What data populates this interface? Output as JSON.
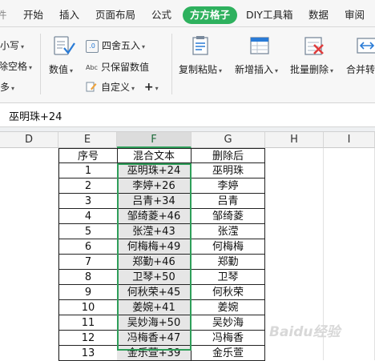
{
  "tabs": [
    {
      "label": "开始"
    },
    {
      "label": "插入"
    },
    {
      "label": "页面布局"
    },
    {
      "label": "公式"
    },
    {
      "label": "方方格子",
      "active": true
    },
    {
      "label": "DIY工具箱"
    },
    {
      "label": "数据"
    },
    {
      "label": "审阅"
    }
  ],
  "ribbon": {
    "lowercase": "小写",
    "remove_spaces": "除空格",
    "more": "多",
    "numeric": "数值",
    "round": "四舍五入",
    "keep_numeric": "只保留数值",
    "custom": "自定义",
    "plus": "+",
    "copy_paste": "复制粘贴",
    "new_insert": "新增插入",
    "batch_delete": "批量删除",
    "merge": "合并转"
  },
  "formula_bar": {
    "content": "巫明珠+24"
  },
  "columns": [
    "D",
    "E",
    "F",
    "G",
    "H",
    "I"
  ],
  "table": {
    "headers": [
      "序号",
      "混合文本",
      "删除后"
    ],
    "rows": [
      [
        "1",
        "巫明珠+24",
        "巫明珠"
      ],
      [
        "2",
        "李婷+26",
        "李婷"
      ],
      [
        "3",
        "吕青+34",
        "吕青"
      ],
      [
        "4",
        "邹绮菱+46",
        "邹绮菱"
      ],
      [
        "5",
        "张滢+43",
        "张滢"
      ],
      [
        "6",
        "何梅梅+49",
        "何梅梅"
      ],
      [
        "7",
        "郑勤+46",
        "郑勤"
      ],
      [
        "8",
        "卫琴+50",
        "卫琴"
      ],
      [
        "9",
        "何秋荣+45",
        "何秋荣"
      ],
      [
        "10",
        "姜婉+41",
        "姜婉"
      ],
      [
        "11",
        "吴妙海+50",
        "吴妙海"
      ],
      [
        "12",
        "冯梅香+47",
        "冯梅香"
      ],
      [
        "13",
        "金乐萱+39",
        "金乐萱"
      ]
    ]
  },
  "watermark": "Baidu经验",
  "colors": {
    "accent": "#2eb15e"
  }
}
